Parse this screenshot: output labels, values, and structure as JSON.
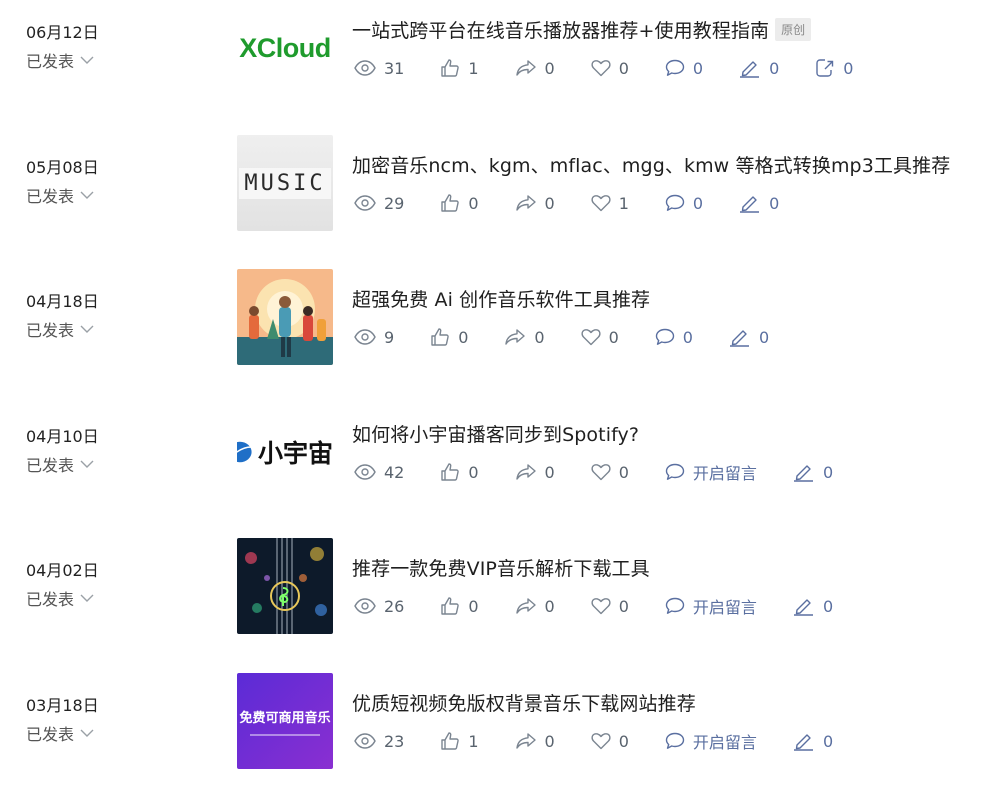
{
  "articles": [
    {
      "date": "06月12日",
      "status": "已发表",
      "thumb_text": "XCloud",
      "title": "一站式跨平台在线音乐播放器推荐+使用教程指南",
      "badge": "原创",
      "views": "31",
      "likes": "1",
      "shares": "0",
      "favs": "0",
      "comments": "0",
      "edits": "0",
      "reposts": "0"
    },
    {
      "date": "05月08日",
      "status": "已发表",
      "thumb_text": "MUSIC",
      "title": "加密音乐ncm、kgm、mflac、mgg、kmw 等格式转换mp3工具推荐",
      "views": "29",
      "likes": "0",
      "shares": "0",
      "favs": "1",
      "comments": "0",
      "edits": "0"
    },
    {
      "date": "04月18日",
      "status": "已发表",
      "title": "超强免费 Ai 创作音乐软件工具推荐",
      "views": "9",
      "likes": "0",
      "shares": "0",
      "favs": "0",
      "comments": "0",
      "edits": "0"
    },
    {
      "date": "04月10日",
      "status": "已发表",
      "thumb_text": "小宇宙",
      "title": "如何将小宇宙播客同步到Spotify?",
      "views": "42",
      "likes": "0",
      "shares": "0",
      "favs": "0",
      "comments": "开启留言",
      "edits": "0"
    },
    {
      "date": "04月02日",
      "status": "已发表",
      "title": "推荐一款免费VIP音乐解析下载工具",
      "views": "26",
      "likes": "0",
      "shares": "0",
      "favs": "0",
      "comments": "开启留言",
      "edits": "0"
    },
    {
      "date": "03月18日",
      "status": "已发表",
      "thumb_text": "免费可商用音乐",
      "title": "优质短视频免版权背景音乐下载网站推荐",
      "views": "23",
      "likes": "1",
      "shares": "0",
      "favs": "0",
      "comments": "开启留言",
      "edits": "0"
    }
  ],
  "colors": {
    "icon": "#7b8591",
    "link": "#5a6fa0",
    "xcloud_green": "#1f9b2d"
  }
}
